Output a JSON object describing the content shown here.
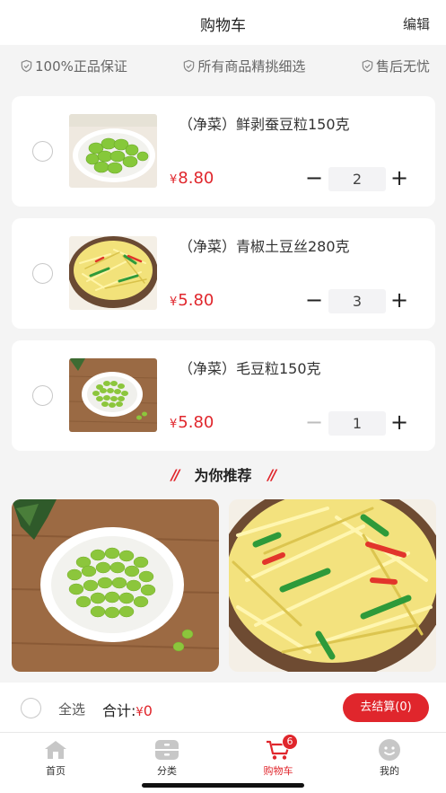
{
  "header": {
    "title": "购物车",
    "edit": "编辑"
  },
  "guarantees": [
    "100%正品保证",
    "所有商品精挑细选",
    "售后无忧"
  ],
  "cart_items": [
    {
      "name": "（净菜）鲜剥蚕豆粒150克",
      "currency": "¥",
      "price": "8.80",
      "quantity": "2",
      "image": "broad-beans-photo"
    },
    {
      "name": "（净菜）青椒土豆丝280克",
      "currency": "¥",
      "price": "5.80",
      "quantity": "3",
      "image": "shredded-potato-pepper-photo"
    },
    {
      "name": "（净菜）毛豆粒150克",
      "currency": "¥",
      "price": "5.80",
      "quantity": "1",
      "image": "edamame-photo"
    }
  ],
  "recommend": {
    "title": "为你推荐"
  },
  "bottom_bar": {
    "select_all": "全选",
    "total_label": "合计:",
    "currency": "¥",
    "total_value": "0",
    "checkout": "去结算(0)"
  },
  "tabbar": [
    {
      "label": "首页",
      "icon": "home-icon"
    },
    {
      "label": "分类",
      "icon": "category-icon"
    },
    {
      "label": "购物车",
      "icon": "cart-icon",
      "badge": "6",
      "active": true
    },
    {
      "label": "我的",
      "icon": "profile-icon"
    }
  ],
  "colors": {
    "accent": "#e0262c",
    "background": "#f4f4f4"
  }
}
